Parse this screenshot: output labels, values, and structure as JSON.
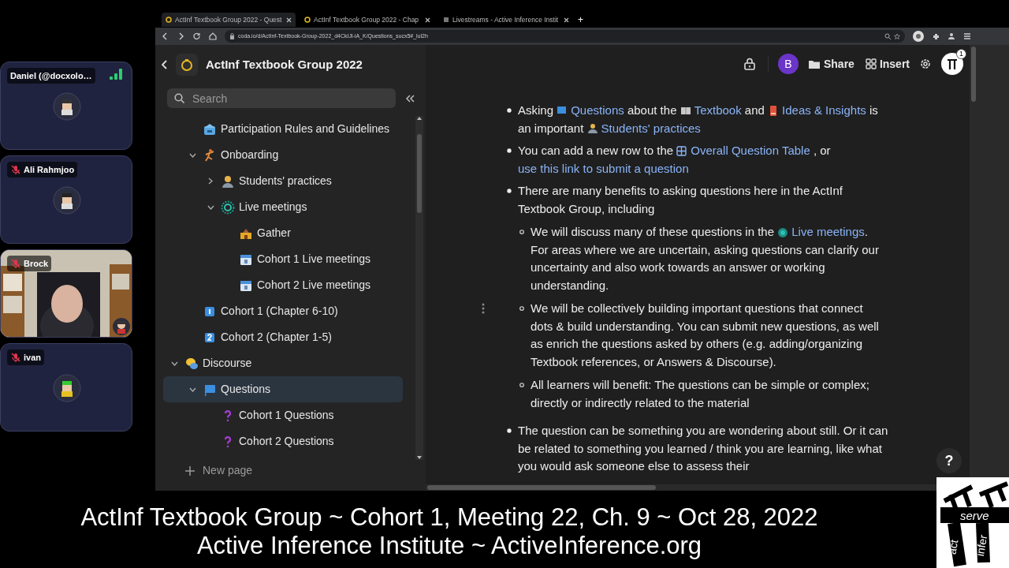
{
  "browser": {
    "tabs": [
      {
        "title": "ActInf Textbook Group 2022 - Quest",
        "selected": true
      },
      {
        "title": "ActInf Textbook Group 2022 - Chap",
        "selected": false
      },
      {
        "title": "Livestreams - Active Inference Instit",
        "selected": false
      }
    ],
    "new_tab": "+",
    "url": "coda.io/d/ActInf-Textbook-Group-2022_d4CkIJl-iA_K/Questions_sucx5#_lul2h"
  },
  "participants": [
    {
      "name": "Daniel (@docxolo…",
      "muted": false,
      "kind": "avatar"
    },
    {
      "name": "Ali Rahmjoo",
      "muted": true,
      "kind": "avatar"
    },
    {
      "name": "Brock",
      "muted": true,
      "kind": "video"
    },
    {
      "name": "ivan",
      "muted": true,
      "kind": "avatar"
    }
  ],
  "doc": {
    "title": "ActInf Textbook Group 2022",
    "search": {
      "placeholder": "Search"
    },
    "tree": [
      {
        "children": [
          {
            "label": "Participation Rules and Guidelines",
            "selected": false
          },
          {
            "label": "Onboarding",
            "selected": false,
            "expanded": true,
            "children": [
              {
                "label": "Students' practices",
                "selected": false,
                "expanded": false
              },
              {
                "label": "Live meetings",
                "selected": false,
                "expanded": true,
                "children": [
                  {
                    "label": "Gather",
                    "selected": false
                  },
                  {
                    "label": "Cohort 1 Live meetings",
                    "selected": false
                  },
                  {
                    "label": "Cohort 2 Live meetings",
                    "selected": false
                  }
                ]
              }
            ]
          },
          {
            "label": "Cohort 1 (Chapter 6-10)",
            "selected": false
          },
          {
            "label": "Cohort 2 (Chapter 1-5)",
            "selected": false
          }
        ]
      },
      {
        "label": "Discourse",
        "selected": false,
        "expanded": true,
        "children": [
          {
            "label": "Questions",
            "selected": true,
            "expanded": true,
            "children": [
              {
                "label": "Cohort 1 Questions",
                "selected": false
              },
              {
                "label": "Cohort 2 Questions",
                "selected": false
              }
            ]
          }
        ]
      }
    ],
    "new_page": "New page",
    "toolbar": {
      "avatar": "B",
      "share": "Share",
      "insert": "Insert",
      "badge": "1"
    },
    "bullets": [
      {
        "parts": [
          {
            "kind": "text",
            "text": "Asking "
          },
          {
            "kind": "link",
            "text": "Questions"
          },
          {
            "kind": "text",
            "text": " about the "
          },
          {
            "kind": "link",
            "text": "Textbook"
          },
          {
            "kind": "text",
            "text": " and "
          },
          {
            "kind": "link",
            "text": "Ideas & Insights"
          },
          {
            "kind": "text",
            "text": " is an important "
          },
          {
            "kind": "link",
            "text": "Students' practices"
          }
        ]
      },
      {
        "parts": [
          {
            "kind": "text",
            "text": "You can add a new row to the "
          },
          {
            "kind": "link",
            "text": "Overall Question Table"
          },
          {
            "kind": "text",
            "text": " , or "
          },
          {
            "kind": "link",
            "text": "use this link to submit a question"
          }
        ]
      },
      {
        "parts": [
          {
            "kind": "text",
            "text": "There are many benefits to asking questions here in the ActInf Textbook Group, including"
          }
        ],
        "children": [
          {
            "parts": [
              {
                "kind": "text",
                "text": "We will discuss many of these questions in the "
              },
              {
                "kind": "link",
                "text": "Live meetings"
              },
              {
                "kind": "text",
                "text": ". For areas where we are uncertain, asking questions can clarify our uncertainty and also work towards an answer or working understanding."
              }
            ]
          },
          {
            "parts": [
              {
                "kind": "text",
                "text": "We will be collectively building important questions that connect dots & build understanding. You can submit new questions, as well as enrich the questions asked by others (e.g. adding/organizing Textbook references, or Answers & Discourse)."
              }
            ]
          },
          {
            "parts": [
              {
                "kind": "text",
                "text": "All learners will benefit: The questions can be simple or complex; directly or indirectly related to the material"
              }
            ]
          }
        ]
      },
      {
        "parts": [
          {
            "kind": "text",
            "text": "The question can be something you are wondering about still. Or it can be related to something you learned / think you are learning, like what you would ask someone else to assess their"
          }
        ]
      }
    ],
    "help": "?"
  },
  "caption": [
    "ActInf Textbook Group ~ Cohort 1, Meeting 22, Ch. 9 ~ Oct 28, 2022",
    "Active Inference Institute ~ ActiveInference.org"
  ],
  "logo": {
    "words": [
      "serve",
      "act",
      "infer"
    ]
  }
}
